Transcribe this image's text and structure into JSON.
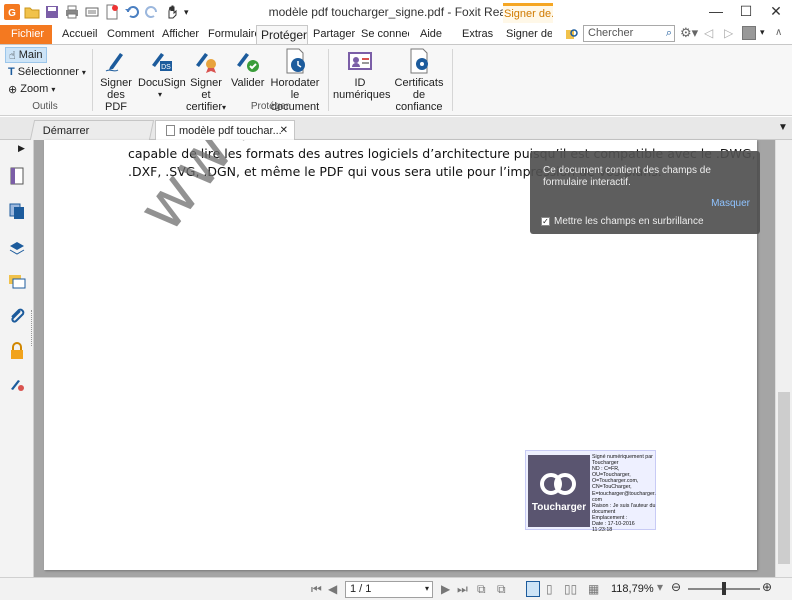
{
  "window": {
    "title": "modèle pdf toucharger_signe.pdf - Foxit Reader",
    "context_tab": "Signer de...",
    "controls": {
      "minimize": "—",
      "maximize": "☐",
      "close": "✕"
    }
  },
  "tabs": {
    "file": "Fichier",
    "items": [
      "Accueil",
      "Commentaire",
      "Afficher",
      "Formulaire",
      "Protéger",
      "Partager",
      "Se connecter",
      "Aide",
      "Extras",
      "Signer des"
    ],
    "active": "Protéger"
  },
  "search": {
    "placeholder": "Chercher"
  },
  "ribbon": {
    "tools": {
      "main": "Main",
      "select": "Sélectionner",
      "zoom": "Zoom",
      "group": "Outils"
    },
    "protect": {
      "sign_pdf": [
        "Signer",
        "des PDF"
      ],
      "docusign": "DocuSign",
      "sign_certify": [
        "Signer et",
        "certifier"
      ],
      "validate": "Valider",
      "timestamp": [
        "Horodater le",
        "document"
      ],
      "digital_ids": [
        "ID",
        "numériques"
      ],
      "trusted_certs": [
        "Certificats",
        "de confiance"
      ],
      "group": "Protéger"
    }
  },
  "doc_tabs": {
    "start": "Démarrer",
    "document": "modèle pdf touchar..."
  },
  "document": {
    "line1": "capable de lire les formats des autres logiciels d’architecture puisqu’il est compatible avec le .DWG,",
    "line2": ".DXF, .SVG, .DGN, et même le PDF qui vous sera utile pour l’impression de vos plans.",
    "watermark": "www.tou"
  },
  "notification": {
    "message": "Ce document contient des champs de formulaire interactif.",
    "hide": "Masquer",
    "highlight": "Mettre les champs en surbrillance",
    "highlight_checked": true
  },
  "signature": {
    "logo_text": "Toucharger",
    "lines": [
      "Signé numériquement par Toucharger",
      "ND : C=FR,",
      "OU=Toucharger,",
      "O=Toucharger.com,",
      "CN=TouCharger,",
      "E=toucharger@toucharger.",
      "com",
      "Raison : Je suis l'auteur du document",
      "Emplacement :",
      "Date : 17-10-2016 11:23:18"
    ]
  },
  "status": {
    "page": "1 / 1",
    "zoom": "118,79%"
  },
  "colors": {
    "accent": "#f47920",
    "link": "#1c5b9c",
    "notif_bg": "#505050"
  }
}
